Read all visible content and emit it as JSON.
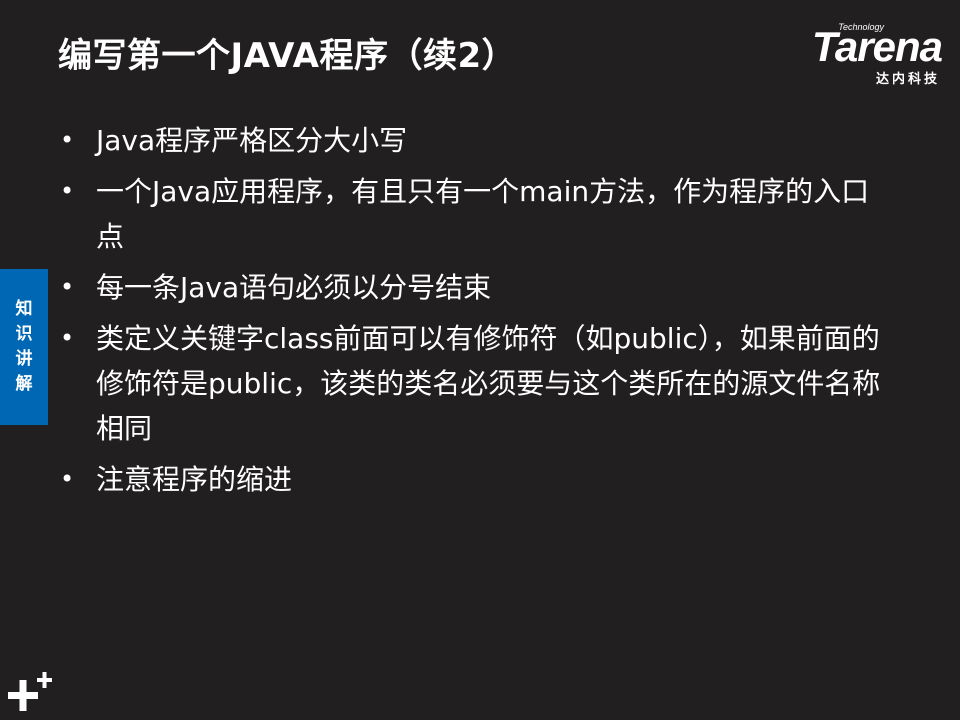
{
  "slide": {
    "title": "编写第一个JAVA程序（续2）",
    "logo": {
      "technology": "Technology",
      "brand": "Tarena",
      "chinese": "达内科技"
    },
    "side_tab": [
      "知",
      "识",
      "讲",
      "解"
    ],
    "bullets": [
      "Java程序严格区分大小写",
      "一个Java应用程序，有且只有一个main方法，作为程序的入口点",
      "每一条Java语句必须以分号结束",
      "类定义关键字class前面可以有修饰符（如public），如果前面的修饰符是public，该类的类名必须要与这个类所在的源文件名称相同",
      "注意程序的缩进"
    ]
  },
  "colors": {
    "background": "#221f20",
    "text": "#ffffff",
    "side_tab": "#0067b5"
  }
}
